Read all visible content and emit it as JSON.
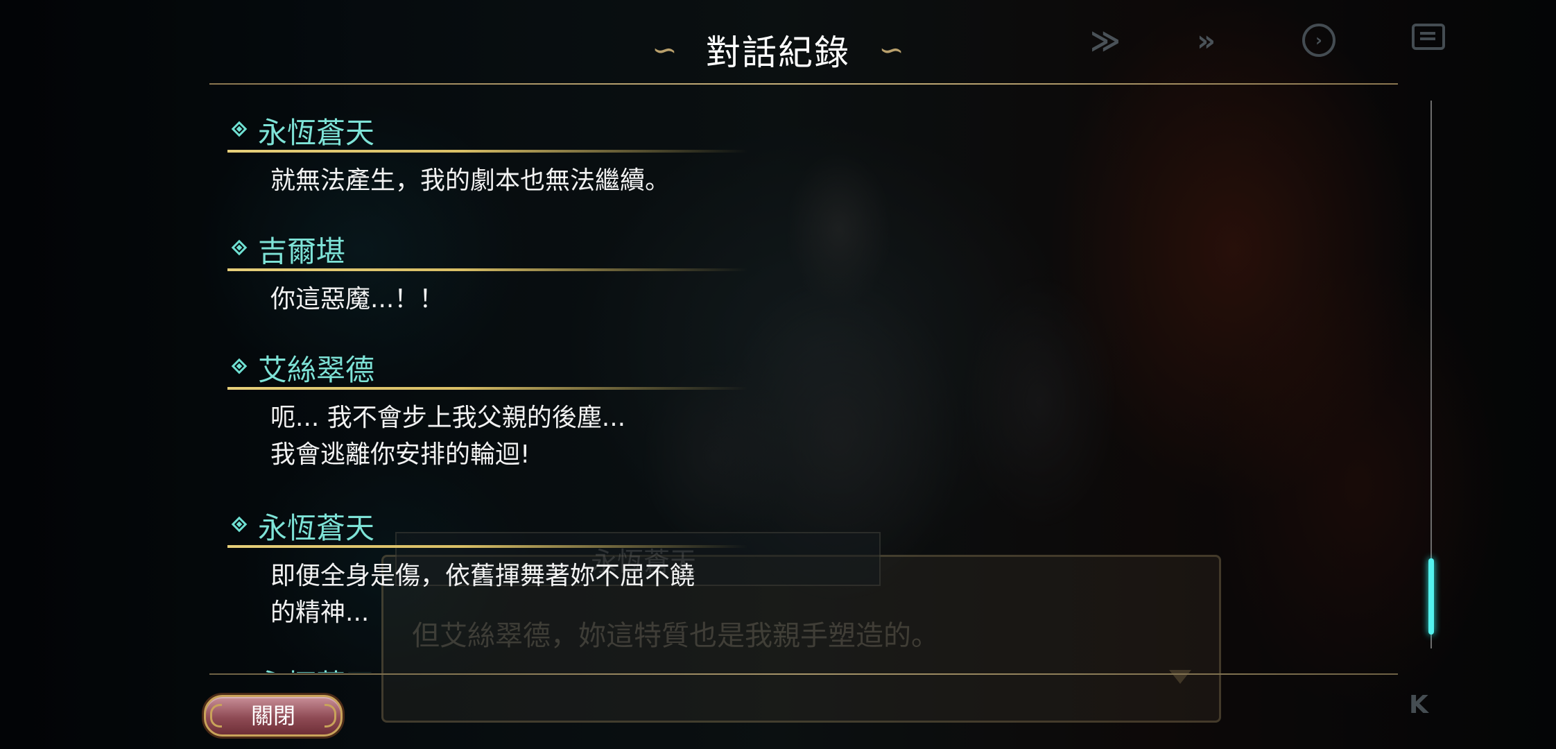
{
  "screen_title": "對話紀錄",
  "title_ornament_left": "∽",
  "title_ornament_right": "∽",
  "top_controls": [
    {
      "icon": "skip-all-icon",
      "glyph": "≫"
    },
    {
      "icon": "fast-forward-icon",
      "glyph": "»"
    },
    {
      "icon": "auto-play-icon",
      "glyph": "›"
    },
    {
      "icon": "log-icon"
    }
  ],
  "background_dialog": {
    "speaker": "永恆蒼天",
    "text": "但艾絲翠德，妳這特質也是我親手塑造的。"
  },
  "log_entries": [
    {
      "speaker": "永恆蒼天",
      "text": "就無法產生，我的劇本也無法繼續。"
    },
    {
      "speaker": "吉爾堪",
      "text": "你這惡魔...！！"
    },
    {
      "speaker": "艾絲翠德",
      "text": "呃... 我不會步上我父親的後塵...\n我會逃離你安排的輪迴!"
    },
    {
      "speaker": "永恆蒼天",
      "text": "即便全身是傷，依舊揮舞著妳不屈不饒\n的精神..."
    },
    {
      "speaker": "永恆蒼天",
      "text": ""
    }
  ],
  "scroll_position": 0.9,
  "close_button_label": "關閉",
  "colors": {
    "speaker": "#7ee3d7",
    "underline": "#e6cf7a",
    "message": "#f2f2f2",
    "scroll_thumb": "#54f2ee",
    "close_button": "#8f4b55"
  }
}
